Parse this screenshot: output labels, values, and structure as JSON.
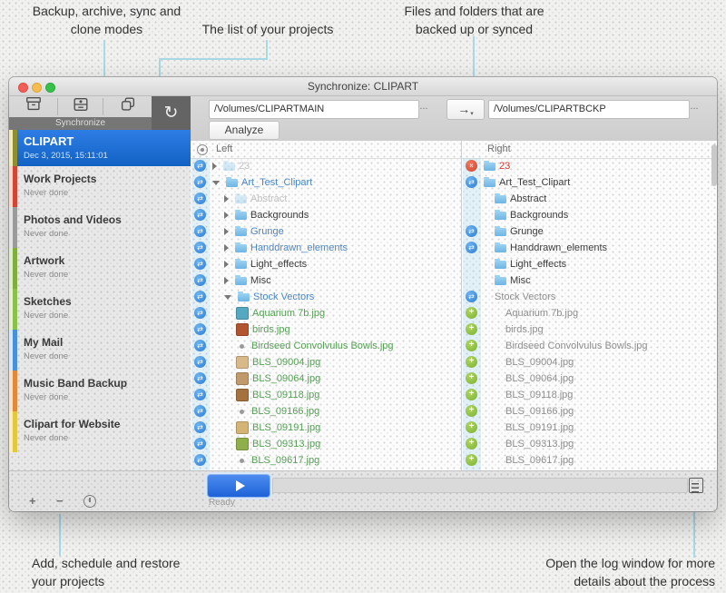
{
  "annotations": {
    "modes": {
      "line1": "Backup, archive, sync and",
      "line2": "clone modes"
    },
    "projects": {
      "line1": "The list of your projects"
    },
    "files": {
      "line1": "Files and folders that are",
      "line2": "backed up or synced"
    },
    "add": {
      "line1": "Add, schedule and restore",
      "line2": "your projects"
    },
    "log": {
      "line1": "Open the log window for more",
      "line2": "details about the process"
    }
  },
  "window": {
    "title": "Synchronize: CLIPART",
    "toolbar": {
      "modes_label": "Synchronize",
      "mode_icons": [
        "backup",
        "archive",
        "clone",
        "synchronize"
      ],
      "left_path": "/Volumes/CLIPARTMAIN",
      "right_path": "/Volumes/CLIPARTBCKP",
      "browse_label": "...",
      "direction_arrow": "→",
      "analyze_label": "Analyze"
    },
    "sidebar": {
      "projects": [
        {
          "name": "CLIPART",
          "subtitle": "Dec 3, 2015, 15:11:01",
          "selected": true,
          "stripe_pale": "#efecc3",
          "stripe_main": "#8f8f2e"
        },
        {
          "name": "Work Projects",
          "subtitle": "Never done",
          "selected": false,
          "stripe_pale": "#f5d9cf",
          "stripe_main": "#d04533"
        },
        {
          "name": "Photos and Videos",
          "subtitle": "Never done",
          "selected": false,
          "stripe_pale": "#e3e3e3",
          "stripe_main": "#9b9b9b"
        },
        {
          "name": "Artwork",
          "subtitle": "Never done",
          "selected": false,
          "stripe_pale": "#e0eccf",
          "stripe_main": "#7fae3e"
        },
        {
          "name": "Sketches",
          "subtitle": "Never done",
          "selected": false,
          "stripe_pale": "#e4f0d0",
          "stripe_main": "#8cc04c"
        },
        {
          "name": "My Mail",
          "subtitle": "Never done",
          "selected": false,
          "stripe_pale": "#d6e8f7",
          "stripe_main": "#4a90d9"
        },
        {
          "name": "Music Band Backup",
          "subtitle": "Never done",
          "selected": false,
          "stripe_pale": "#f7e3cd",
          "stripe_main": "#e0893a"
        },
        {
          "name": "Clipart for Website",
          "subtitle": "Never done",
          "selected": false,
          "stripe_pale": "#f7eec7",
          "stripe_main": "#e3c83d"
        }
      ]
    },
    "filepanes": {
      "left_header": "Left",
      "right_header": "Right",
      "rows": [
        {
          "indent": 0,
          "left": {
            "status_icon": "sync",
            "disclosure": "collapsed",
            "item_icon": "folder-faint",
            "name": "23",
            "text_style": "faint"
          },
          "right": {
            "status_icon": "error",
            "item_icon": "folder",
            "name": "23",
            "text_style": "red"
          }
        },
        {
          "indent": 0,
          "left": {
            "status_icon": "sync",
            "disclosure": "expanded",
            "item_icon": "folder",
            "name": "Art_Test_Clipart",
            "text_style": "blue"
          },
          "right": {
            "status_icon": "sync",
            "item_icon": "folder",
            "name": "Art_Test_Clipart",
            "text_style": "dark"
          }
        },
        {
          "indent": 1,
          "left": {
            "status_icon": "sync",
            "disclosure": "collapsed",
            "item_icon": "folder-faint",
            "name": "Abstract",
            "text_style": "faint"
          },
          "right": {
            "status_icon": "",
            "item_icon": "folder",
            "name": "Abstract",
            "text_style": "dark"
          }
        },
        {
          "indent": 1,
          "left": {
            "status_icon": "sync",
            "disclosure": "collapsed",
            "item_icon": "folder",
            "name": "Backgrounds",
            "text_style": "dark"
          },
          "right": {
            "status_icon": "",
            "item_icon": "folder",
            "name": "Backgrounds",
            "text_style": "dark"
          }
        },
        {
          "indent": 1,
          "left": {
            "status_icon": "sync",
            "disclosure": "collapsed",
            "item_icon": "folder",
            "name": "Grunge",
            "text_style": "blue"
          },
          "right": {
            "status_icon": "sync",
            "item_icon": "folder",
            "name": "Grunge",
            "text_style": "dark"
          }
        },
        {
          "indent": 1,
          "left": {
            "status_icon": "sync",
            "disclosure": "collapsed",
            "item_icon": "folder",
            "name": "Handdrawn_elements",
            "text_style": "blue"
          },
          "right": {
            "status_icon": "sync",
            "item_icon": "folder",
            "name": "Handdrawn_elements",
            "text_style": "dark"
          }
        },
        {
          "indent": 1,
          "left": {
            "status_icon": "sync",
            "disclosure": "collapsed",
            "item_icon": "folder",
            "name": "Light_effects",
            "text_style": "dark"
          },
          "right": {
            "status_icon": "",
            "item_icon": "folder",
            "name": "Light_effects",
            "text_style": "dark"
          }
        },
        {
          "indent": 1,
          "left": {
            "status_icon": "sync",
            "disclosure": "collapsed",
            "item_icon": "folder",
            "name": "Misc",
            "text_style": "dark"
          },
          "right": {
            "status_icon": "",
            "item_icon": "folder",
            "name": "Misc",
            "text_style": "dark"
          }
        },
        {
          "indent": 1,
          "left": {
            "status_icon": "sync",
            "disclosure": "expanded",
            "item_icon": "folder",
            "name": "Stock Vectors",
            "text_style": "blue"
          },
          "right": {
            "status_icon": "sync",
            "item_icon": "",
            "name": "Stock Vectors",
            "text_style": "gray"
          }
        },
        {
          "indent": 2,
          "left": {
            "status_icon": "sync",
            "item_icon": "thumb",
            "thumb_color": "#54a8c0",
            "name": "Aquarium 7b.jpg",
            "text_style": "green"
          },
          "right": {
            "status_icon": "add",
            "item_icon": "",
            "name": "Aquarium 7b.jpg",
            "text_style": "gray"
          }
        },
        {
          "indent": 2,
          "left": {
            "status_icon": "sync",
            "item_icon": "thumb",
            "thumb_color": "#b35430",
            "name": "birds.jpg",
            "text_style": "green"
          },
          "right": {
            "status_icon": "add",
            "item_icon": "",
            "name": "birds.jpg",
            "text_style": "gray"
          }
        },
        {
          "indent": 2,
          "left": {
            "status_icon": "sync",
            "item_icon": "dot",
            "name": "Birdseed Convolvulus Bowls.jpg",
            "text_style": "green"
          },
          "right": {
            "status_icon": "add",
            "item_icon": "",
            "name": "Birdseed Convolvulus Bowls.jpg",
            "text_style": "gray"
          }
        },
        {
          "indent": 2,
          "left": {
            "status_icon": "sync",
            "item_icon": "thumb",
            "thumb_color": "#d8b98a",
            "name": "BLS_09004.jpg",
            "text_style": "green"
          },
          "right": {
            "status_icon": "add",
            "item_icon": "",
            "name": "BLS_09004.jpg",
            "text_style": "gray"
          }
        },
        {
          "indent": 2,
          "left": {
            "status_icon": "sync",
            "item_icon": "thumb",
            "thumb_color": "#c09a6a",
            "name": "BLS_09064.jpg",
            "text_style": "green"
          },
          "right": {
            "status_icon": "add",
            "item_icon": "",
            "name": "BLS_09064.jpg",
            "text_style": "gray"
          }
        },
        {
          "indent": 2,
          "left": {
            "status_icon": "sync",
            "item_icon": "thumb",
            "thumb_color": "#a5713f",
            "name": "BLS_09118.jpg",
            "text_style": "green"
          },
          "right": {
            "status_icon": "add",
            "item_icon": "",
            "name": "BLS_09118.jpg",
            "text_style": "gray"
          }
        },
        {
          "indent": 2,
          "left": {
            "status_icon": "sync",
            "item_icon": "dot",
            "name": "BLS_09166.jpg",
            "text_style": "green"
          },
          "right": {
            "status_icon": "add",
            "item_icon": "",
            "name": "BLS_09166.jpg",
            "text_style": "gray"
          }
        },
        {
          "indent": 2,
          "left": {
            "status_icon": "sync",
            "item_icon": "thumb",
            "thumb_color": "#d4b475",
            "name": "BLS_09191.jpg",
            "text_style": "green"
          },
          "right": {
            "status_icon": "add",
            "item_icon": "",
            "name": "BLS_09191.jpg",
            "text_style": "gray"
          }
        },
        {
          "indent": 2,
          "left": {
            "status_icon": "sync",
            "item_icon": "thumb",
            "thumb_color": "#8faf4a",
            "name": "BLS_09313.jpg",
            "text_style": "green"
          },
          "right": {
            "status_icon": "add",
            "item_icon": "",
            "name": "BLS_09313.jpg",
            "text_style": "gray"
          }
        },
        {
          "indent": 2,
          "left": {
            "status_icon": "sync",
            "item_icon": "dot",
            "name": "BLS_09617.jpg",
            "text_style": "green"
          },
          "right": {
            "status_icon": "add",
            "item_icon": "",
            "name": "BLS_09617.jpg",
            "text_style": "gray"
          }
        }
      ]
    },
    "bottom": {
      "status": "Ready"
    }
  },
  "colors": {
    "selected_project": "#1668d0",
    "callout_line": "#a9d8e6",
    "sync_icon": "#2f7cd2",
    "error_icon": "#d2422f",
    "add_icon": "#7cb335",
    "green_text": "#55a055",
    "blue_text": "#4a86c8",
    "red_text": "#d9382a"
  }
}
